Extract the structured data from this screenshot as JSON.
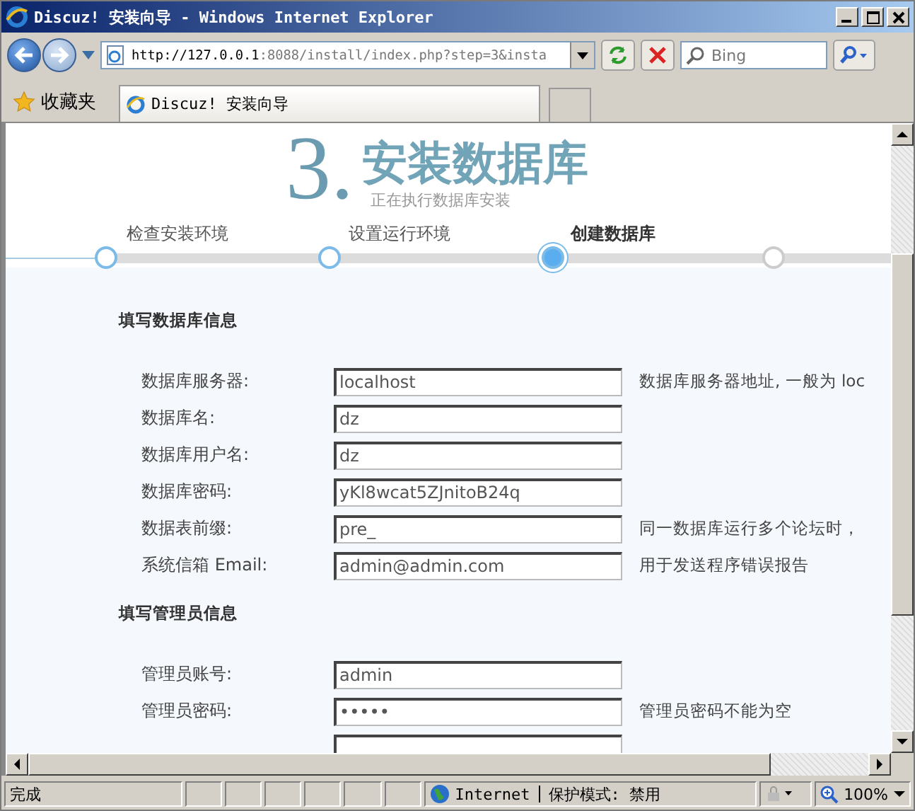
{
  "window": {
    "title": "Discuz! 安装向导 - Windows Internet Explorer"
  },
  "address_bar": {
    "url_host": "http://127.0.0.1",
    "url_rest": ":8088/install/index.php?step=3&insta"
  },
  "search": {
    "placeholder": "Bing"
  },
  "favorites": {
    "label": "收藏夹"
  },
  "tabs": [
    {
      "label": "Discuz! 安装向导",
      "selected": true
    }
  ],
  "header": {
    "number": "3.",
    "title": "安装数据库",
    "subtitle": "正在执行数据库安装"
  },
  "steps": [
    {
      "label": "检查安装环境",
      "done": true,
      "selected": false
    },
    {
      "label": "设置运行环境",
      "done": true,
      "selected": false
    },
    {
      "label": "创建数据库",
      "done": true,
      "selected": true
    },
    {
      "done": false,
      "selected": false
    }
  ],
  "sections": [
    {
      "title": "填写数据库信息",
      "fields": [
        {
          "kind": "text",
          "label": "数据库服务器:",
          "value": "localhost",
          "hint": "数据库服务器地址, 一般为 loc"
        },
        {
          "kind": "text",
          "label": "数据库名:",
          "value": "dz"
        },
        {
          "kind": "text",
          "label": "数据库用户名:",
          "value": "dz"
        },
        {
          "kind": "text",
          "label": "数据库密码:",
          "value": "yKl8wcat5ZJnitoB24q"
        },
        {
          "kind": "text",
          "label": "数据表前缀:",
          "value": "pre_",
          "hint": "同一数据库运行多个论坛时，"
        },
        {
          "kind": "text",
          "label": "系统信箱 Email:",
          "value": "admin@admin.com",
          "hint": "用于发送程序错误报告"
        }
      ]
    },
    {
      "title": "填写管理员信息",
      "fields": [
        {
          "kind": "text",
          "label": "管理员账号:",
          "value": "admin"
        },
        {
          "kind": "text",
          "label": "管理员密码:",
          "value": "•••••",
          "hint": "管理员密码不能为空"
        },
        {
          "kind": "text"
        }
      ]
    }
  ],
  "status_bar": {
    "text": "完成",
    "zone": "Internet",
    "protected_mode": "保护模式: 禁用",
    "zoom": "100%"
  }
}
